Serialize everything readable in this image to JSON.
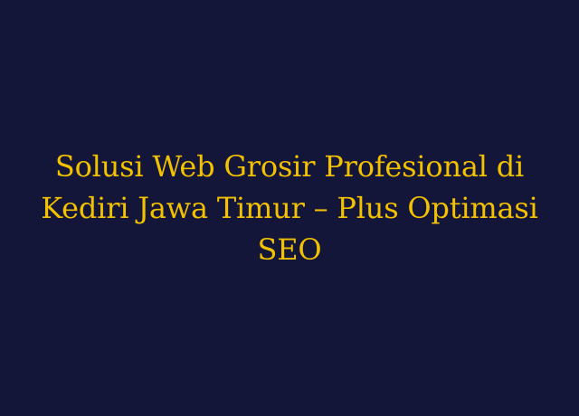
{
  "colors": {
    "background": "#131539",
    "title_text": "#f2c100"
  },
  "title": "Solusi Web Grosir Profesional di Kediri Jawa Timur – Plus Optimasi SEO"
}
